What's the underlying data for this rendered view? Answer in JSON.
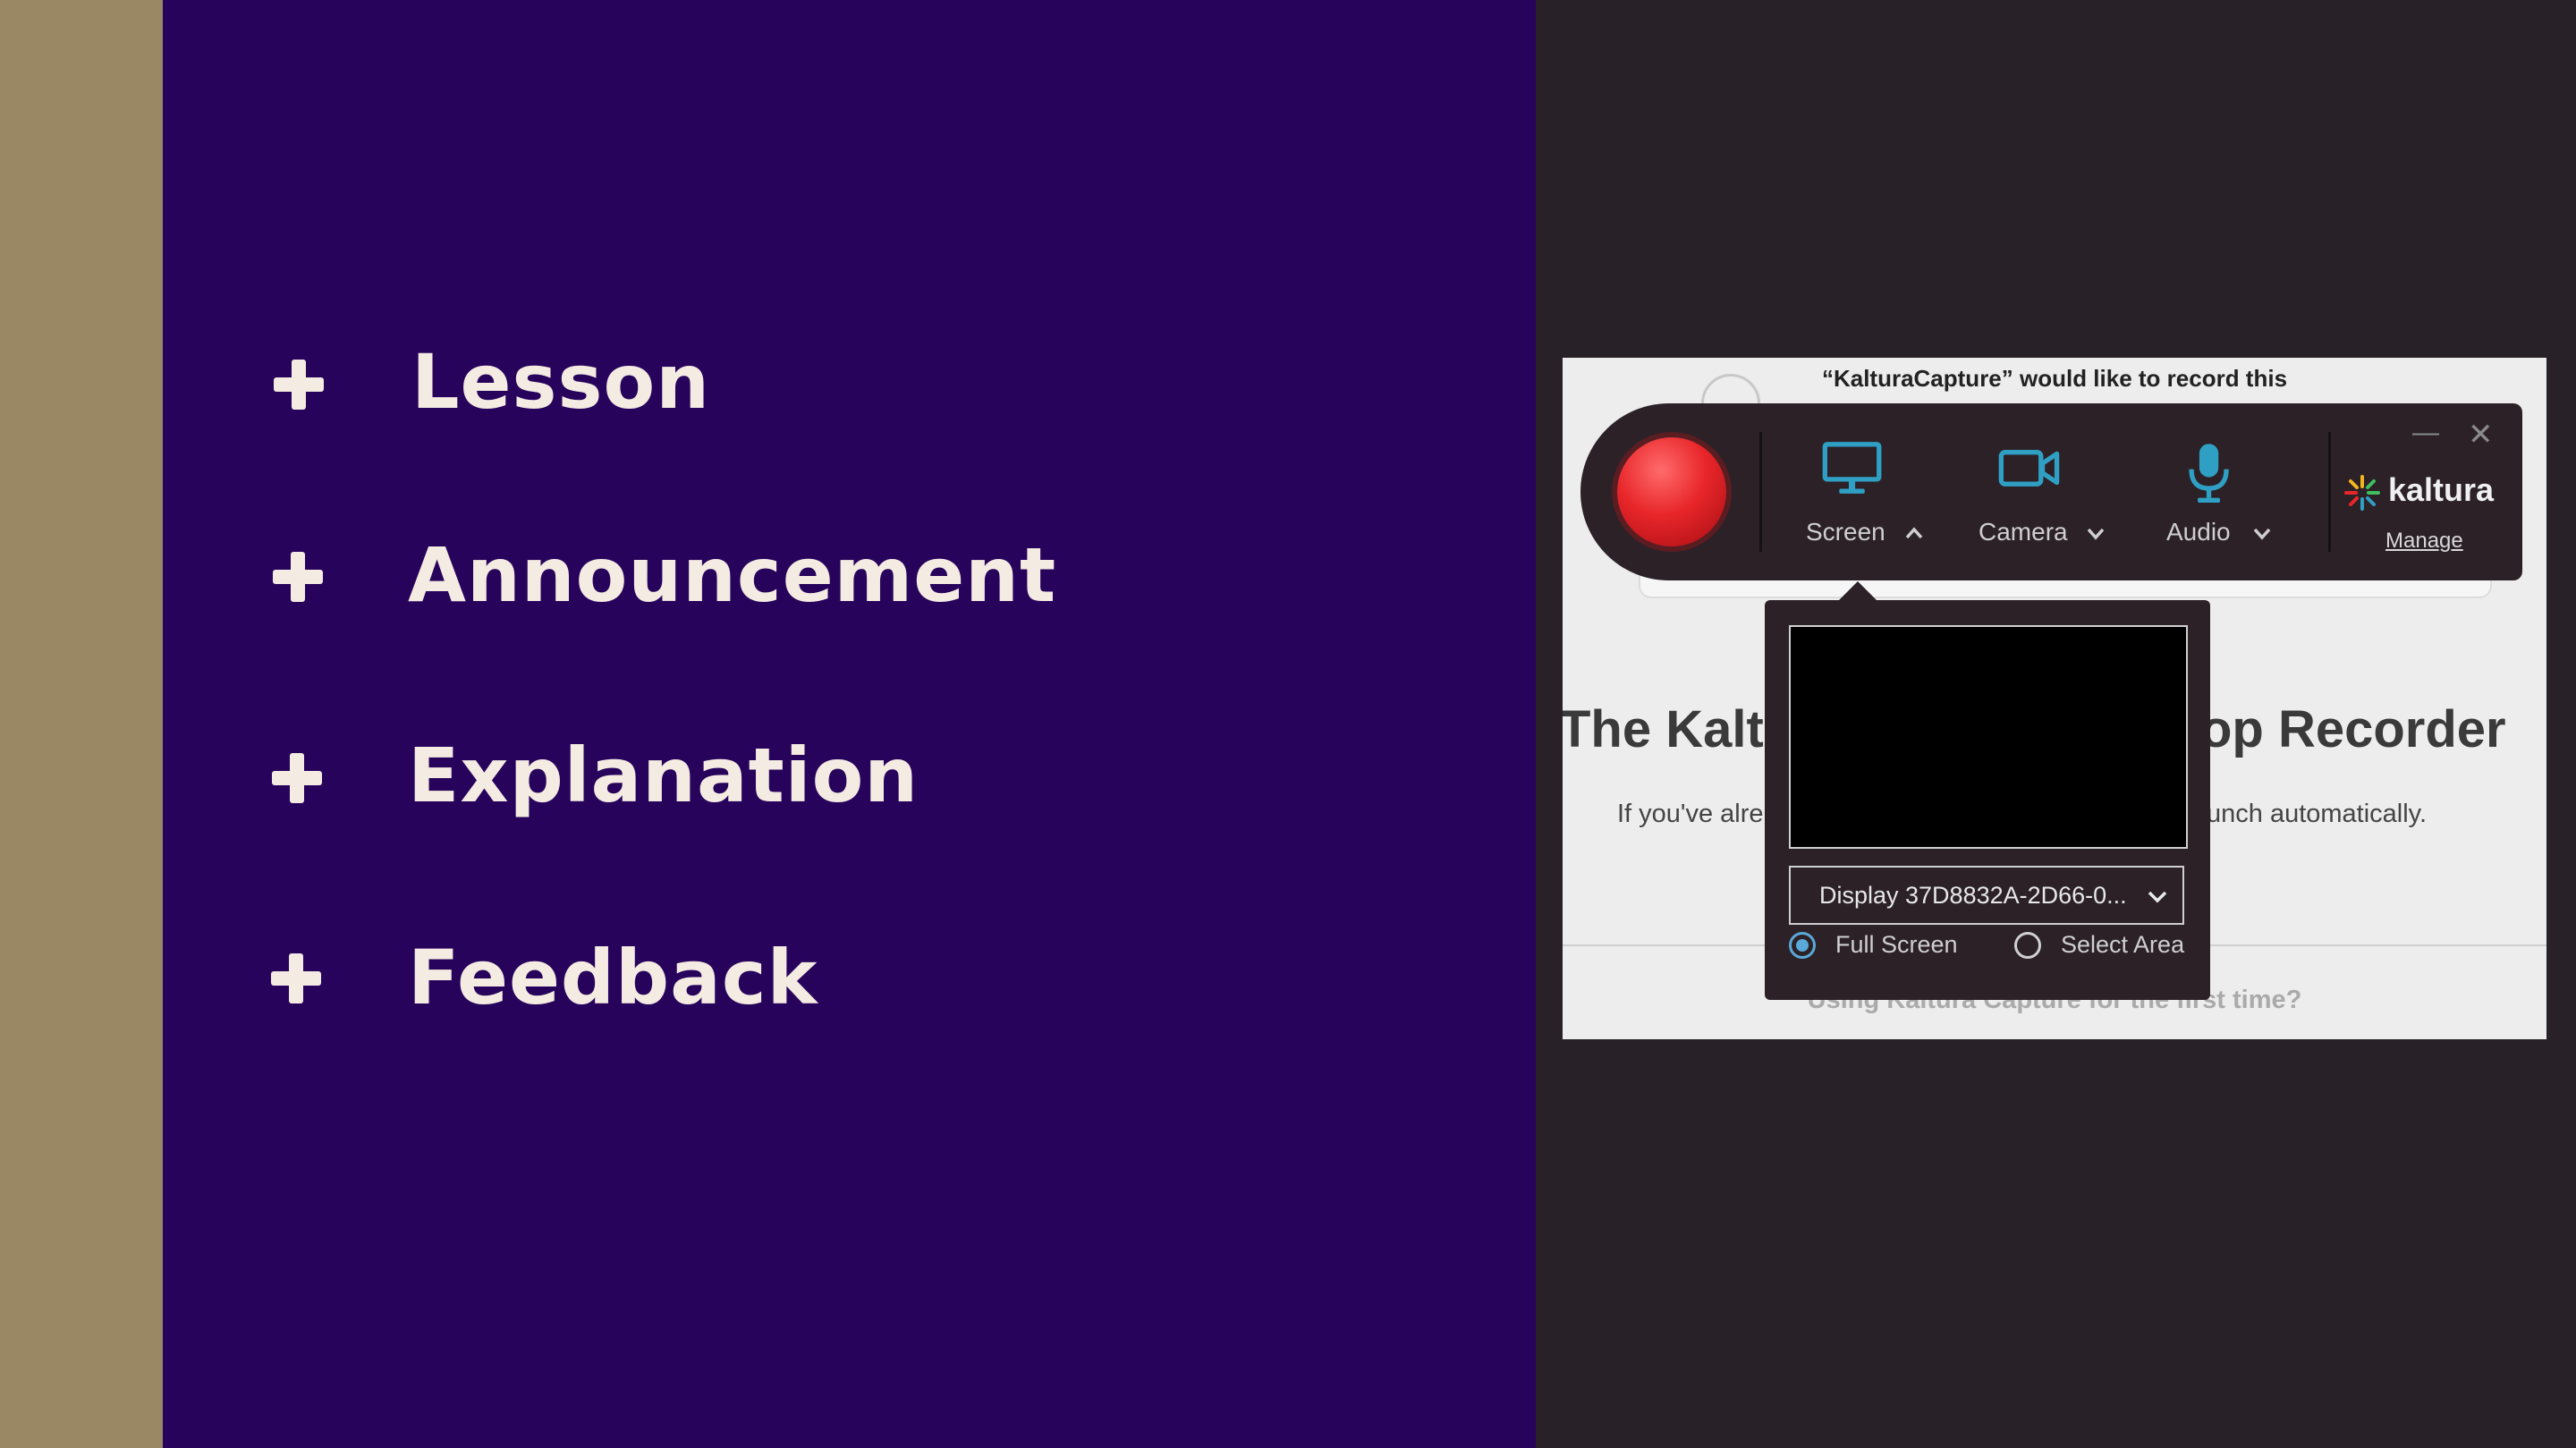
{
  "slide": {
    "bullets": [
      "Lesson",
      "Announcement",
      "Explanation",
      "Feedback"
    ]
  },
  "capture_page": {
    "permission_text": "“KalturaCapture” would like to record this",
    "heading_left": "The Kalt",
    "heading_right": "op Recorder",
    "sub_left": "If you've alre",
    "sub_right": "unch automatically.",
    "first_time_link": "Using Kaltura Capture for the first time?"
  },
  "toolbar": {
    "screen_label": "Screen",
    "camera_label": "Camera",
    "audio_label": "Audio",
    "brand": "kaltura",
    "manage_label": "Manage",
    "minimize_glyph": "—",
    "close_glyph": "✕",
    "icon_color": "#2fa0c4",
    "record_color": "#e8262a"
  },
  "screen_dropdown": {
    "display_value": "Display 37D8832A-2D66-0...",
    "options": [
      {
        "label": "Full Screen",
        "selected": true
      },
      {
        "label": "Select Area",
        "selected": false
      }
    ]
  },
  "colors": {
    "gold": "#9a8763",
    "purple": "#28035c",
    "dark": "#282128"
  }
}
